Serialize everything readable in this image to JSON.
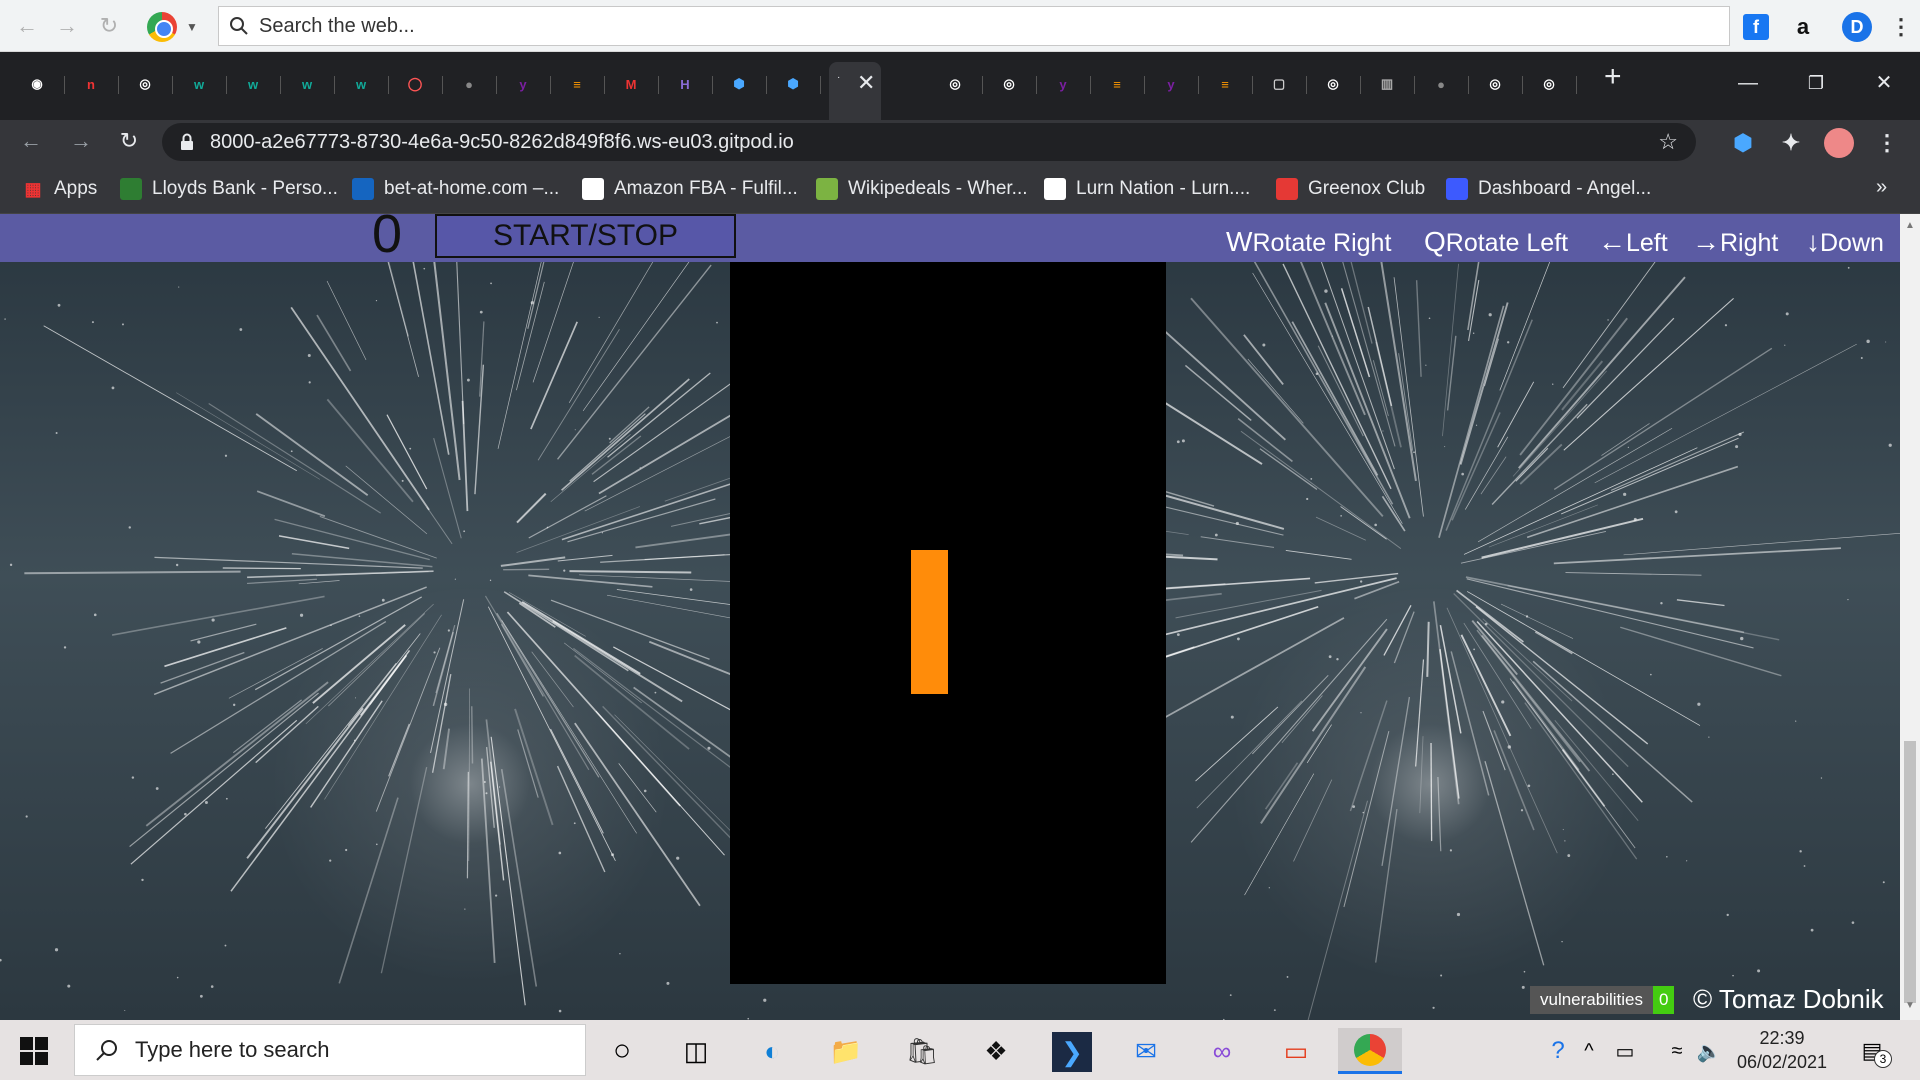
{
  "browser": {
    "search_placeholder": "Search the web...",
    "url": "8000-a2e67773-8730-4e6a-9c50-8262d849f8f6.ws-eu03.gitpod.io",
    "apps_label": "Apps",
    "bookmarks": [
      {
        "label": "Lloyds Bank - Perso...",
        "icon": "lloyds-icon",
        "color": "#2e7d32"
      },
      {
        "label": "bet-at-home.com –...",
        "icon": "bet-at-home-icon",
        "color": "#1565c0"
      },
      {
        "label": "Amazon FBA - Fulfil...",
        "icon": "amazon-icon",
        "color": "#ffffff"
      },
      {
        "label": "Wikipedeals - Wher...",
        "icon": "wikipedeals-icon",
        "color": "#7cb342"
      },
      {
        "label": "Lurn Nation - Lurn....",
        "icon": "lurn-icon",
        "color": "#ffffff"
      },
      {
        "label": "Greenox Club",
        "icon": "greenox-icon",
        "color": "#e53935"
      },
      {
        "label": "Dashboard - Angel...",
        "icon": "dashboard-icon",
        "color": "#3d5afe"
      }
    ],
    "tabs": [
      "tab-1",
      "tab-2",
      "tab-3",
      "tab-4",
      "tab-5",
      "tab-6",
      "tab-7",
      "tab-8",
      "tab-9",
      "tab-10",
      "tab-11",
      "tab-12",
      "tab-13",
      "tab-14",
      "tab-15",
      "tab-16",
      "tab-17",
      "tab-18",
      "tab-19",
      "tab-20",
      "tab-21",
      "tab-22",
      "tab-23",
      "tab-24",
      "tab-25",
      "tab-26",
      "tab-27",
      "tab-28",
      "tab-29",
      "tab-30"
    ]
  },
  "game": {
    "score": "0",
    "start_stop_label": "START/STOP",
    "controls": [
      {
        "key": "W",
        "action": "Rotate Right"
      },
      {
        "key": "Q",
        "action": "Rotate Left"
      },
      {
        "key": "←",
        "action": "Left"
      },
      {
        "key": "→",
        "action": "Right"
      },
      {
        "key": "↓",
        "action": "Down"
      }
    ],
    "piece_color": "#ff8c0a",
    "header_color": "#5b5ba3",
    "vulnerabilities_label": "vulnerabilities",
    "vulnerabilities_count": "0",
    "copyright": "© Tomaz Dobnik"
  },
  "taskbar": {
    "search_placeholder": "Type here to search",
    "time": "22:39",
    "date": "06/02/2021",
    "notification_count": "3"
  }
}
